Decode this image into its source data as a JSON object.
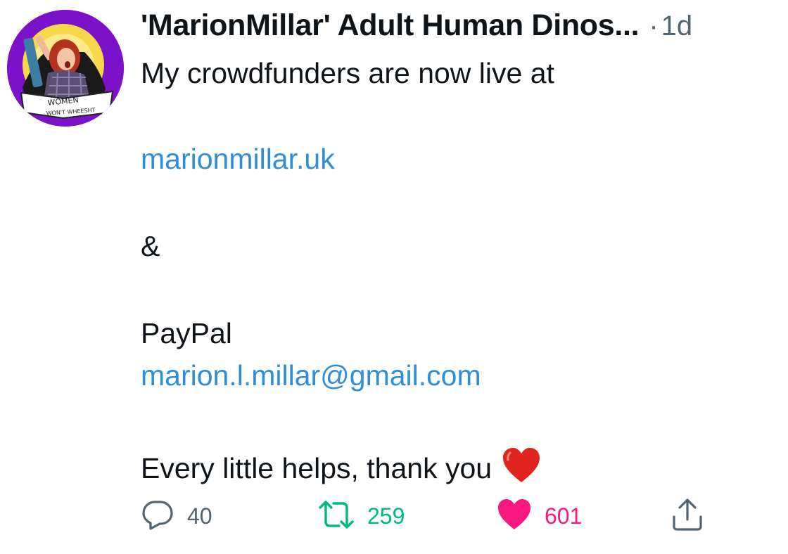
{
  "tweet": {
    "display_name": "'MarionMillar' Adult Human Dinos...",
    "separator": "·",
    "timestamp": "1d",
    "avatar_banner_line1": "WOMEN",
    "avatar_banner_line2": "WON'T WHEESHT",
    "lines": {
      "intro": "My crowdfunders are now live at",
      "site_link": "marionmillar.uk",
      "ampersand": "&",
      "paypal_label": "PayPal",
      "email_link": "marion.l.millar@gmail.com",
      "thanks": "Every little helps, thank you"
    },
    "emoji": "red-heart-emoji"
  },
  "actions": {
    "reply_count": "40",
    "retweet_count": "259",
    "like_count": "601"
  },
  "icons": {
    "reply": "speech-bubble-icon",
    "retweet": "retweet-arrows-icon",
    "like": "heart-filled-icon",
    "share": "share-upload-icon"
  },
  "colors": {
    "text": "#0f1419",
    "secondary": "#536471",
    "link": "#2f8ed6",
    "retweet": "#00ba7c",
    "like": "#f91880",
    "avatar_bg": "#7b12c9"
  }
}
